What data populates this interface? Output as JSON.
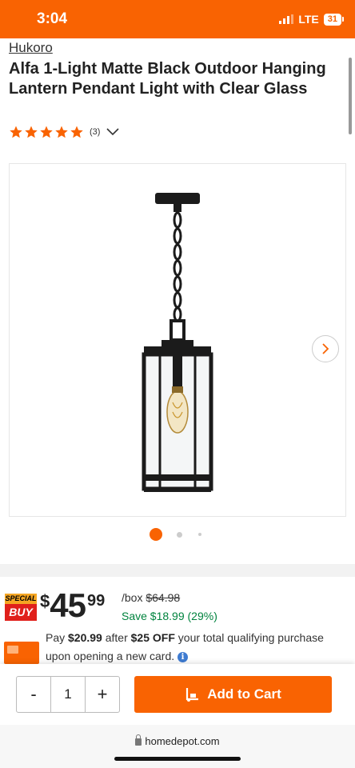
{
  "status_bar": {
    "time": "3:04",
    "network": "LTE",
    "battery": "31"
  },
  "product": {
    "brand": "Hukoro",
    "title": "Alfa 1-Light Matte Black Outdoor Hanging Lantern Pendant Light with Clear Glass",
    "rating_stars": 5,
    "review_count": "(3)"
  },
  "gallery": {
    "current_index": 1,
    "total": 3
  },
  "pricing": {
    "badge_top": "SPECIAL",
    "badge_bottom": "BUY",
    "currency": "$",
    "dollars": "45",
    "cents": "99",
    "unit": "/box",
    "was_price": "$64.98",
    "save_text": "Save $18.99 (29%)"
  },
  "credit_offer": {
    "prefix": "Pay",
    "pay_amount": "$20.99",
    "middle": "after",
    "discount": "$25 OFF",
    "suffix": "your total qualifying purchase upon opening a new card."
  },
  "cart": {
    "minus_label": "-",
    "quantity": "1",
    "plus_label": "+",
    "add_label": "Add to Cart"
  },
  "browser": {
    "url": "homedepot.com"
  },
  "colors": {
    "brand_orange": "#f96302",
    "save_green": "#00833e",
    "special_red": "#e0201b",
    "special_yellow": "#f5a623"
  }
}
